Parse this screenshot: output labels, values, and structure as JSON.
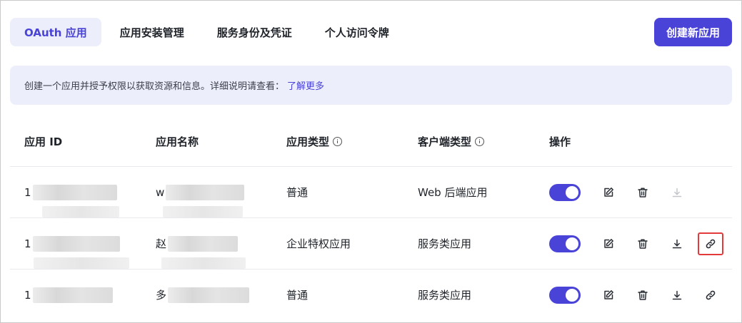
{
  "tabs": [
    {
      "label": "OAuth 应用",
      "active": true
    },
    {
      "label": "应用安装管理",
      "active": false
    },
    {
      "label": "服务身份及凭证",
      "active": false
    },
    {
      "label": "个人访问令牌",
      "active": false
    }
  ],
  "create_button": "创建新应用",
  "notice": {
    "text": "创建一个应用并授予权限以获取资源和信息。详细说明请查看：",
    "link": "了解更多"
  },
  "table": {
    "headers": {
      "id": "应用 ID",
      "name": "应用名称",
      "type": "应用类型",
      "client": "客户端类型",
      "ops": "操作"
    },
    "rows": [
      {
        "id_prefix": "1",
        "name_prefix": "w",
        "type": "普通",
        "client": "Web 后端应用",
        "enabled": true,
        "download_enabled": false,
        "has_link": false
      },
      {
        "id_prefix": "1",
        "name_prefix": "赵",
        "type": "企业特权应用",
        "client": "服务类应用",
        "enabled": true,
        "download_enabled": true,
        "has_link": true,
        "link_highlighted": true
      },
      {
        "id_prefix": "1",
        "name_prefix": "多",
        "type": "普通",
        "client": "服务类应用",
        "enabled": true,
        "download_enabled": true,
        "has_link": true
      }
    ]
  },
  "icons": {
    "info": "info-icon",
    "edit": "edit-icon",
    "delete": "trash-icon",
    "download": "download-icon",
    "link": "link-icon"
  },
  "colors": {
    "accent": "#4a43d8",
    "notice_bg": "#eceefb",
    "highlight": "#e33b3b"
  }
}
